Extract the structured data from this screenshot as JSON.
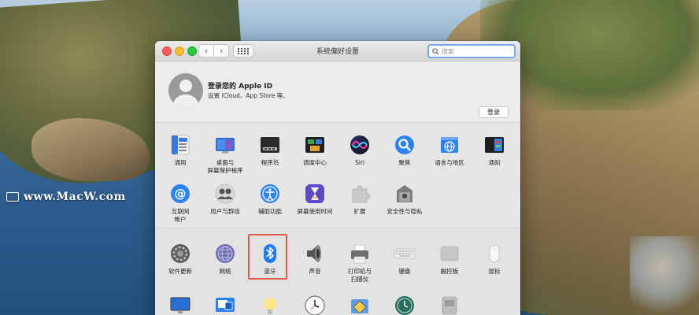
{
  "watermark": {
    "text": "www.MacW.com"
  },
  "window": {
    "title": "系统偏好设置",
    "search_placeholder": "搜索",
    "nav_back": "‹",
    "nav_forward": "›"
  },
  "apple_id": {
    "title": "登录您的 Apple ID",
    "subtitle": "设置 iCloud、App Store 等。",
    "login_label": "登录"
  },
  "section1": {
    "row1": [
      {
        "label": "通用",
        "icon": "general-icon"
      },
      {
        "label": "桌面与\n屏幕保护程序",
        "icon": "desktop-icon"
      },
      {
        "label": "程序坞",
        "icon": "dock-icon"
      },
      {
        "label": "调度中心",
        "icon": "mission-control-icon"
      },
      {
        "label": "Siri",
        "icon": "siri-icon"
      },
      {
        "label": "聚焦",
        "icon": "spotlight-icon"
      },
      {
        "label": "语言与地区",
        "icon": "language-icon"
      },
      {
        "label": "通知",
        "icon": "notifications-icon"
      }
    ],
    "row2": [
      {
        "label": "互联网\n帐户",
        "icon": "internet-accounts-icon"
      },
      {
        "label": "用户与群组",
        "icon": "users-icon"
      },
      {
        "label": "辅助功能",
        "icon": "accessibility-icon"
      },
      {
        "label": "屏幕使用时间",
        "icon": "screen-time-icon"
      },
      {
        "label": "扩展",
        "icon": "extensions-icon"
      },
      {
        "label": "安全性与隐私",
        "icon": "security-icon"
      }
    ]
  },
  "section2": {
    "row1": [
      {
        "label": "软件更新",
        "icon": "software-update-icon"
      },
      {
        "label": "网络",
        "icon": "network-icon"
      },
      {
        "label": "蓝牙",
        "icon": "bluetooth-icon"
      },
      {
        "label": "声音",
        "icon": "sound-icon"
      },
      {
        "label": "打印机与\n扫描仪",
        "icon": "printer-icon"
      },
      {
        "label": "键盘",
        "icon": "keyboard-icon"
      },
      {
        "label": "触控板",
        "icon": "trackpad-icon"
      },
      {
        "label": "鼠标",
        "icon": "mouse-icon"
      }
    ],
    "row2": [
      {
        "label": "",
        "icon": "displays-icon"
      },
      {
        "label": "",
        "icon": "sidecar-icon"
      },
      {
        "label": "",
        "icon": "energy-saver-icon"
      },
      {
        "label": "",
        "icon": "date-time-icon"
      },
      {
        "label": "",
        "icon": "sharing-icon"
      },
      {
        "label": "",
        "icon": "time-machine-icon"
      },
      {
        "label": "",
        "icon": "startup-disk-icon"
      }
    ]
  },
  "colors": {
    "highlight": "#e05a4d",
    "bluetooth": "#1f7bf2",
    "search_ring": "#7aa7e7"
  }
}
